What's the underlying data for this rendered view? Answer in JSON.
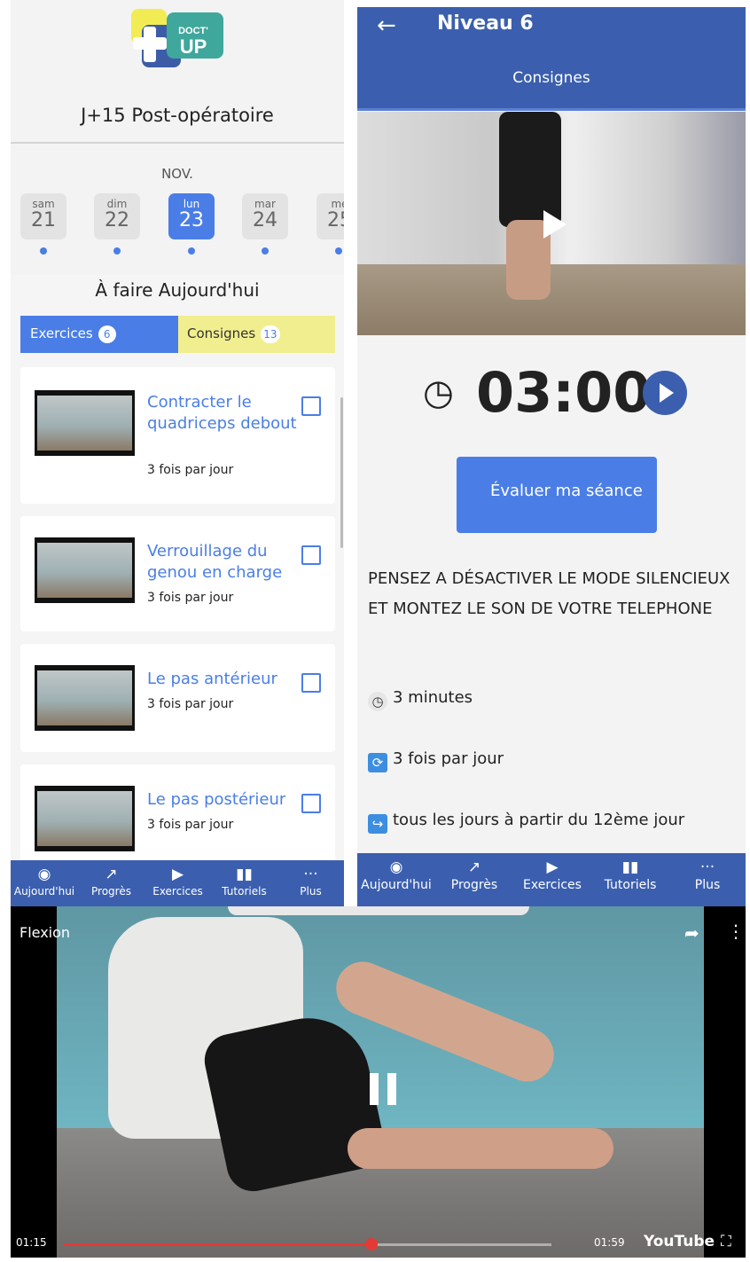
{
  "left_screen": {
    "logo": {
      "line1": "DOCT'",
      "line2": "UP",
      "colors": {
        "yellow": "#f2ec54",
        "blue": "#3d5ca8",
        "teal": "#3fa79c"
      }
    },
    "title": "J+15 Post-opératoire",
    "month": "NOV.",
    "days": [
      {
        "name": "sam",
        "num": "21"
      },
      {
        "name": "dim",
        "num": "22"
      },
      {
        "name": "lun",
        "num": "23",
        "selected": true
      },
      {
        "name": "mar",
        "num": "24"
      },
      {
        "name": "me",
        "num": "25"
      }
    ],
    "todo_title": "À faire Aujourd'hui",
    "tabs": {
      "exercises_label": "Exercices",
      "exercises_count": "6",
      "instructions_label": "Consignes",
      "instructions_count": "13"
    },
    "exercises": [
      {
        "title": "Contracter le quadriceps debout",
        "frequency": "3 fois par jour"
      },
      {
        "title": "Verrouillage du genou en charge",
        "frequency": "3 fois par jour"
      },
      {
        "title": "Le pas antérieur",
        "frequency": "3  fois par jour"
      },
      {
        "title": "Le pas postérieur",
        "frequency": "3 fois par jour"
      }
    ]
  },
  "nav": {
    "items": [
      {
        "label": "Aujourd'hui",
        "icon": "today-icon"
      },
      {
        "label": "Progrès",
        "icon": "progress-icon"
      },
      {
        "label": "Exercices",
        "icon": "play-circle-icon"
      },
      {
        "label": "Tutoriels",
        "icon": "book-icon"
      },
      {
        "label": "Plus",
        "icon": "more-dots-icon"
      }
    ]
  },
  "right_screen": {
    "header_title": "Niveau 6",
    "tab_label": "Consignes",
    "timer": "03:00",
    "evaluate_button": "Évaluer ma séance",
    "warning": "PENSEZ A DÉSACTIVER LE MODE SILENCIEUX  ET MONTEZ LE SON DE VOTRE TELEPHONE",
    "duration": "3 minutes",
    "frequency": "3 fois par jour",
    "schedule": "tous les jours à partir du 12ème jour"
  },
  "video": {
    "title": "Flexion",
    "current_time": "01:15",
    "duration": "01:59",
    "progress": 0.63,
    "brand": "YouTube"
  },
  "colors": {
    "primary": "#4a7ee6",
    "header": "#3b5fae",
    "instructions_tab": "#f1ee8f",
    "progress_red": "#e53935"
  }
}
